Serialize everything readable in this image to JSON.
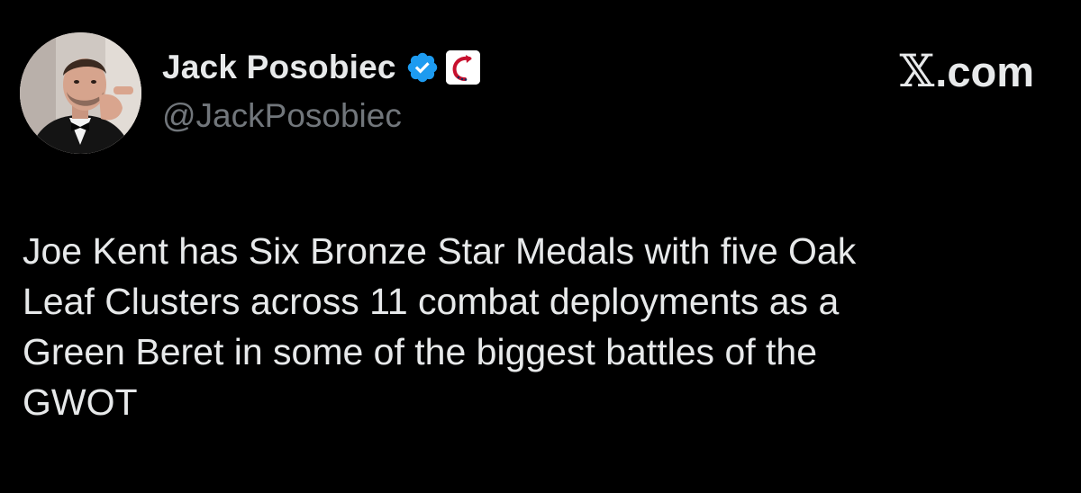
{
  "author": {
    "display_name": "Jack Posobiec",
    "handle": "@JackPosobiec",
    "avatar_icon": "profile-photo",
    "verified_icon": "blue-verified-check-icon",
    "affiliate_icon": "red-curved-arrow-affiliate-badge-icon"
  },
  "brand": {
    "x_glyph": "𝕏",
    "suffix": ".com"
  },
  "tweet": {
    "lines": [
      "Joe Kent has Six Bronze Star Medals with five Oak",
      "Leaf Clusters across 11 combat deployments as a",
      "Green Beret in some of the biggest battles of the",
      "GWOT"
    ]
  },
  "colors": {
    "background": "#000000",
    "primary_text": "#e7e9ea",
    "secondary_text": "#71767b",
    "verified_blue": "#1d9bf0",
    "affiliate_red": "#c8102e"
  }
}
